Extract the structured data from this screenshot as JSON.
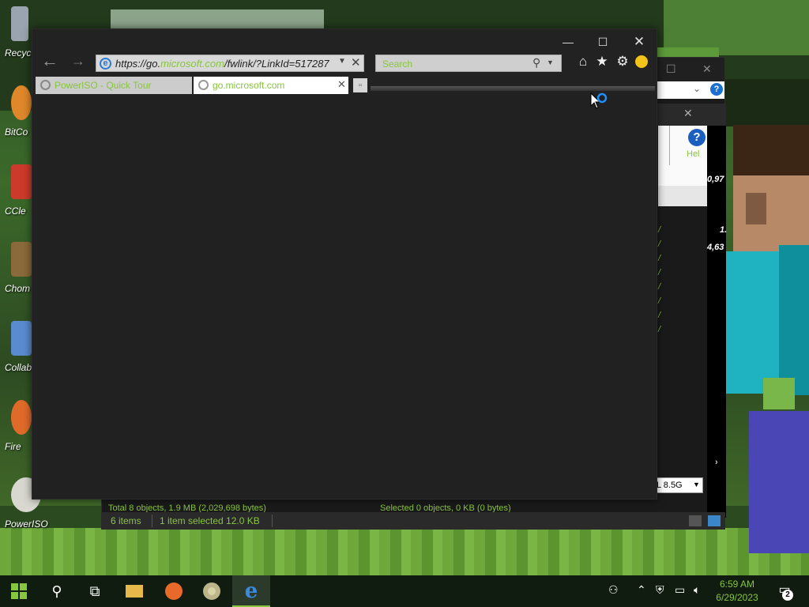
{
  "desktop": {
    "icons": [
      {
        "label": "Recyc",
        "color": "#9aa4b0"
      },
      {
        "label": "BitCo",
        "color": "#e0872a"
      },
      {
        "label": "CCle",
        "color": "#cc3a2b"
      },
      {
        "label": "Chom",
        "color": "#8a6a3a"
      },
      {
        "label": "Collab",
        "color": "#5a8ad0"
      },
      {
        "label": "Fire",
        "color": "#e06a2a"
      },
      {
        "label": "PowerISO",
        "color": "#d8d8d0"
      }
    ]
  },
  "background_window": {
    "side_values": [
      "0,97",
      "1.",
      "4,63"
    ],
    "help_label": "Hel",
    "status_left": "Total 8 objects, 1.9 MB (2,029,698 bytes)",
    "status_right": "Selected 0 objects, 0 KB (0 bytes)",
    "drive_select": "L 8.5G",
    "explorer_status": {
      "items": "6 items",
      "selected": "1 item selected  12.0 KB"
    }
  },
  "browser": {
    "address_prefix": "https://go.",
    "address_domain": "microsoft.com",
    "address_suffix": "/fwlink/?LinkId=517287",
    "search_placeholder": "Search",
    "tabs": [
      {
        "label": "PowerISO - Quick Tour",
        "active": false
      },
      {
        "label": "go.microsoft.com",
        "active": true
      }
    ]
  },
  "taskbar": {
    "time": "6:59 AM",
    "date": "6/29/2023",
    "notification_count": "2"
  },
  "colors": {
    "accent": "#88c53f",
    "window_bg": "#222222"
  }
}
